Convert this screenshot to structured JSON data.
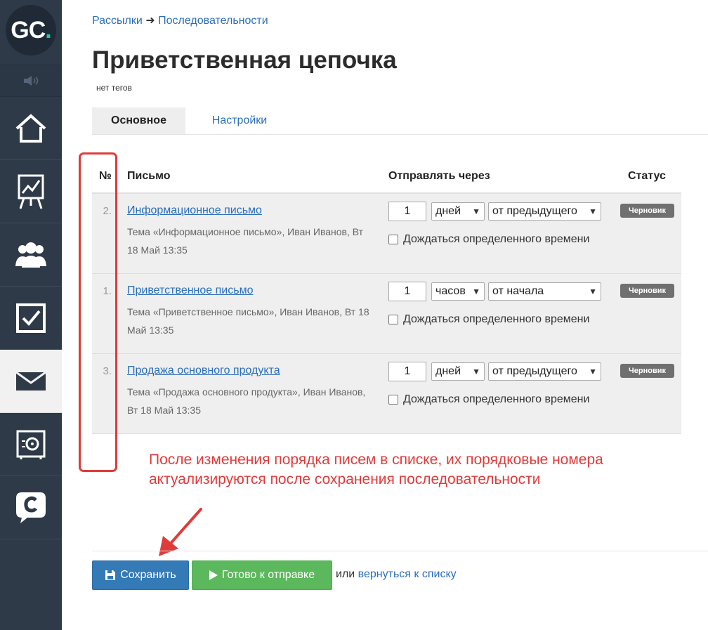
{
  "sidebar": {
    "logo_text": "GC",
    "logo_dot": ".",
    "items": [
      {
        "name": "home-icon"
      },
      {
        "name": "chart-icon"
      },
      {
        "name": "users-icon"
      },
      {
        "name": "tasks-icon"
      },
      {
        "name": "mail-icon",
        "active": true
      },
      {
        "name": "safe-icon"
      },
      {
        "name": "chat-icon"
      }
    ]
  },
  "breadcrumb": {
    "item1": "Рассылки",
    "separator": "➜",
    "item2": "Последовательности"
  },
  "page": {
    "title": "Приветственная цепочка",
    "tags": "нет тегов"
  },
  "tabs": {
    "main": "Основное",
    "settings": "Настройки"
  },
  "table": {
    "headers": {
      "num": "№",
      "letter": "Письмо",
      "send_after": "Отправлять через",
      "status": "Статус"
    },
    "rows": [
      {
        "num": "2.",
        "title": "Информационное письмо",
        "subject": "Тема «Информационное письмо», Иван Иванов, Вт 18 Май 13:35",
        "amount": "1",
        "unit": "дней",
        "relative": "от предыдущего",
        "wait_label": "Дождаться определенного времени",
        "status": "Черновик"
      },
      {
        "num": "1.",
        "title": "Приветственное письмо",
        "subject": "Тема «Приветственное письмо», Иван Иванов, Вт 18 Май 13:35",
        "amount": "1",
        "unit": "часов",
        "relative": "от начала",
        "wait_label": "Дождаться определенного времени",
        "status": "Черновик"
      },
      {
        "num": "3.",
        "title": "Продажа основного продукта",
        "subject": "Тема «Продажа основного продукта», Иван Иванов, Вт 18 Май 13:35",
        "amount": "1",
        "unit": "дней",
        "relative": "от предыдущего",
        "wait_label": "Дождаться определенного времени",
        "status": "Черновик"
      }
    ]
  },
  "annotation": {
    "text": "После изменения порядка писем в списке, их порядковые номера актуализируются после сохранения последовательности",
    "color": "#e03b3b"
  },
  "footer": {
    "save_label": "Сохранить",
    "ready_label": "Готово к отправке",
    "or_text": "или",
    "back_link": "вернуться к списку"
  }
}
